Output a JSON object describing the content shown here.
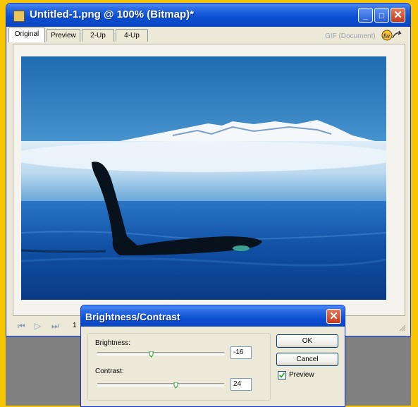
{
  "window": {
    "title": "Untitled-1.png @  100% (Bitmap)*",
    "minimize": "_",
    "maximize": "□",
    "close": "✕",
    "tabs": [
      {
        "label": "Original",
        "active": true
      },
      {
        "label": "Preview",
        "active": false
      },
      {
        "label": "2-Up",
        "active": false
      },
      {
        "label": "4-Up",
        "active": false
      }
    ],
    "format_label": "GIF (Document)",
    "export_icon": "export-wizard-icon",
    "nav": {
      "first": "⏮",
      "play": "▷",
      "last": "⏭",
      "frame": "1"
    }
  },
  "image": {
    "subject": "orca-fin-mountains-photo"
  },
  "dialog": {
    "title": "Brightness/Contrast",
    "close": "✕",
    "brightness_label": "Brightness:",
    "brightness_value": "-16",
    "contrast_label": "Contrast:",
    "contrast_value": "24",
    "ok_label": "OK",
    "cancel_label": "Cancel",
    "preview_label": "Preview",
    "preview_checked": true
  },
  "colors": {
    "titlebar": "#0a4fd2",
    "desktop": "#f7c600",
    "workspace": "#808080"
  }
}
